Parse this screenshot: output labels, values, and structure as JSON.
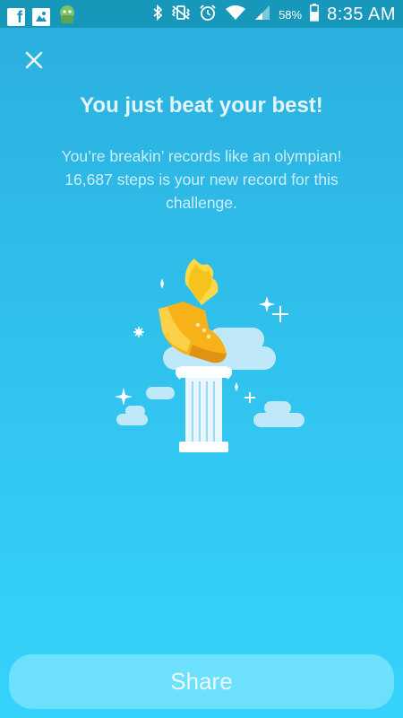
{
  "status_bar": {
    "battery_percent": "58%",
    "time": "8:35 AM",
    "icons": [
      "facebook-icon",
      "image-icon",
      "android-app-icon",
      "bluetooth-icon",
      "vibrate-icon",
      "alarm-icon",
      "wifi-icon",
      "signal-icon",
      "battery-icon"
    ]
  },
  "dialog": {
    "close_icon": "close-icon",
    "title": "You just beat your best!",
    "message_line1": "You’re breakin’ records like an olympian!",
    "message_line2": "16,687 steps is your new record for this",
    "message_line3": "challenge.",
    "illustration": "winged-shoe-on-pillar"
  },
  "share_button": {
    "label": "Share"
  },
  "colors": {
    "background_top": "#2aaedd",
    "background_bottom": "#35d3fb",
    "status_bar": "#1797b9",
    "button": "#6ce0fc",
    "shoe": "#f7b21a"
  }
}
